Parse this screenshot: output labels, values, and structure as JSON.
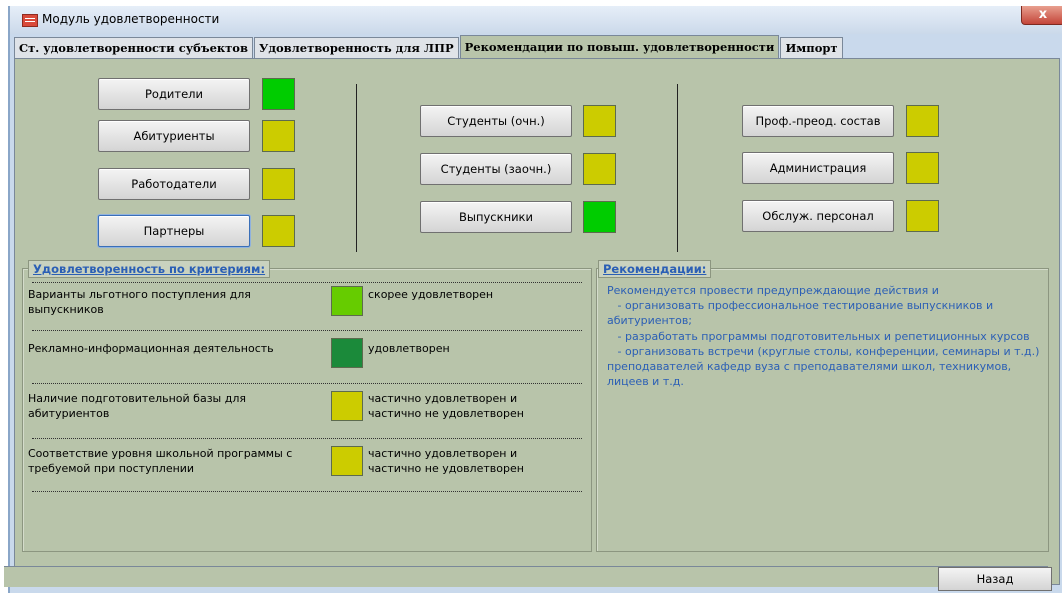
{
  "window": {
    "title": "Модуль удовлетворенности",
    "close_glyph": "x"
  },
  "tabs": [
    {
      "label": "Ст. удовлетворенности субъектов"
    },
    {
      "label": "Удовлетворенность для ЛПР"
    },
    {
      "label": "Рекомендации по повыш. удовлетворенности"
    },
    {
      "label": "Импорт"
    }
  ],
  "colors": {
    "green": "#00cc00",
    "yellow": "#cccc00",
    "light_green": "#66cc00",
    "dark_green": "#1b8a3a"
  },
  "subjects": {
    "col1": [
      {
        "label": "Родители",
        "status": "green"
      },
      {
        "label": "Абитуриенты",
        "status": "yellow"
      },
      {
        "label": "Работодатели",
        "status": "yellow"
      },
      {
        "label": "Партнеры",
        "status": "yellow"
      }
    ],
    "col2": [
      {
        "label": "Студенты (очн.)",
        "status": "yellow"
      },
      {
        "label": "Студенты (заочн.)",
        "status": "yellow"
      },
      {
        "label": "Выпускники",
        "status": "green"
      }
    ],
    "col3": [
      {
        "label": "Проф.-преод. состав",
        "status": "yellow"
      },
      {
        "label": "Администрация",
        "status": "yellow"
      },
      {
        "label": "Обслуж. персонал",
        "status": "yellow"
      }
    ]
  },
  "criteria_panel": {
    "title": "Удовлетворенность по критериям:",
    "rows": [
      {
        "text": "Варианты льготного поступления для выпускников",
        "status": "скорее удовлетворен",
        "color": "light_green"
      },
      {
        "text": "Рекламно-информационная деятельность",
        "status": "удовлетворен",
        "color": "dark_green"
      },
      {
        "text": "Наличие подготовительной базы для абитуриентов",
        "status": "частично удовлетворен и частично не удовлетворен",
        "color": "yellow"
      },
      {
        "text": "Соответствие уровня школьной программы с требуемой при поступлении",
        "status": "частично удовлетворен и частично не удовлетворен",
        "color": "yellow"
      }
    ]
  },
  "recommendations_panel": {
    "title": "Рекомендации:",
    "text": "Рекомендуется провести предупреждающие действия и\n   - организовать профессиональное тестирование выпускников и абитуриентов;\n   - разработать программы подготовительных и репетиционных курсов\n   - организовать встречи (круглые столы, конференции, семинары и т.д.) преподавателей кафедр вуза с преподавателями школ, техникумов, лицеев и т.д."
  },
  "footer": {
    "back_label": "Назад"
  }
}
